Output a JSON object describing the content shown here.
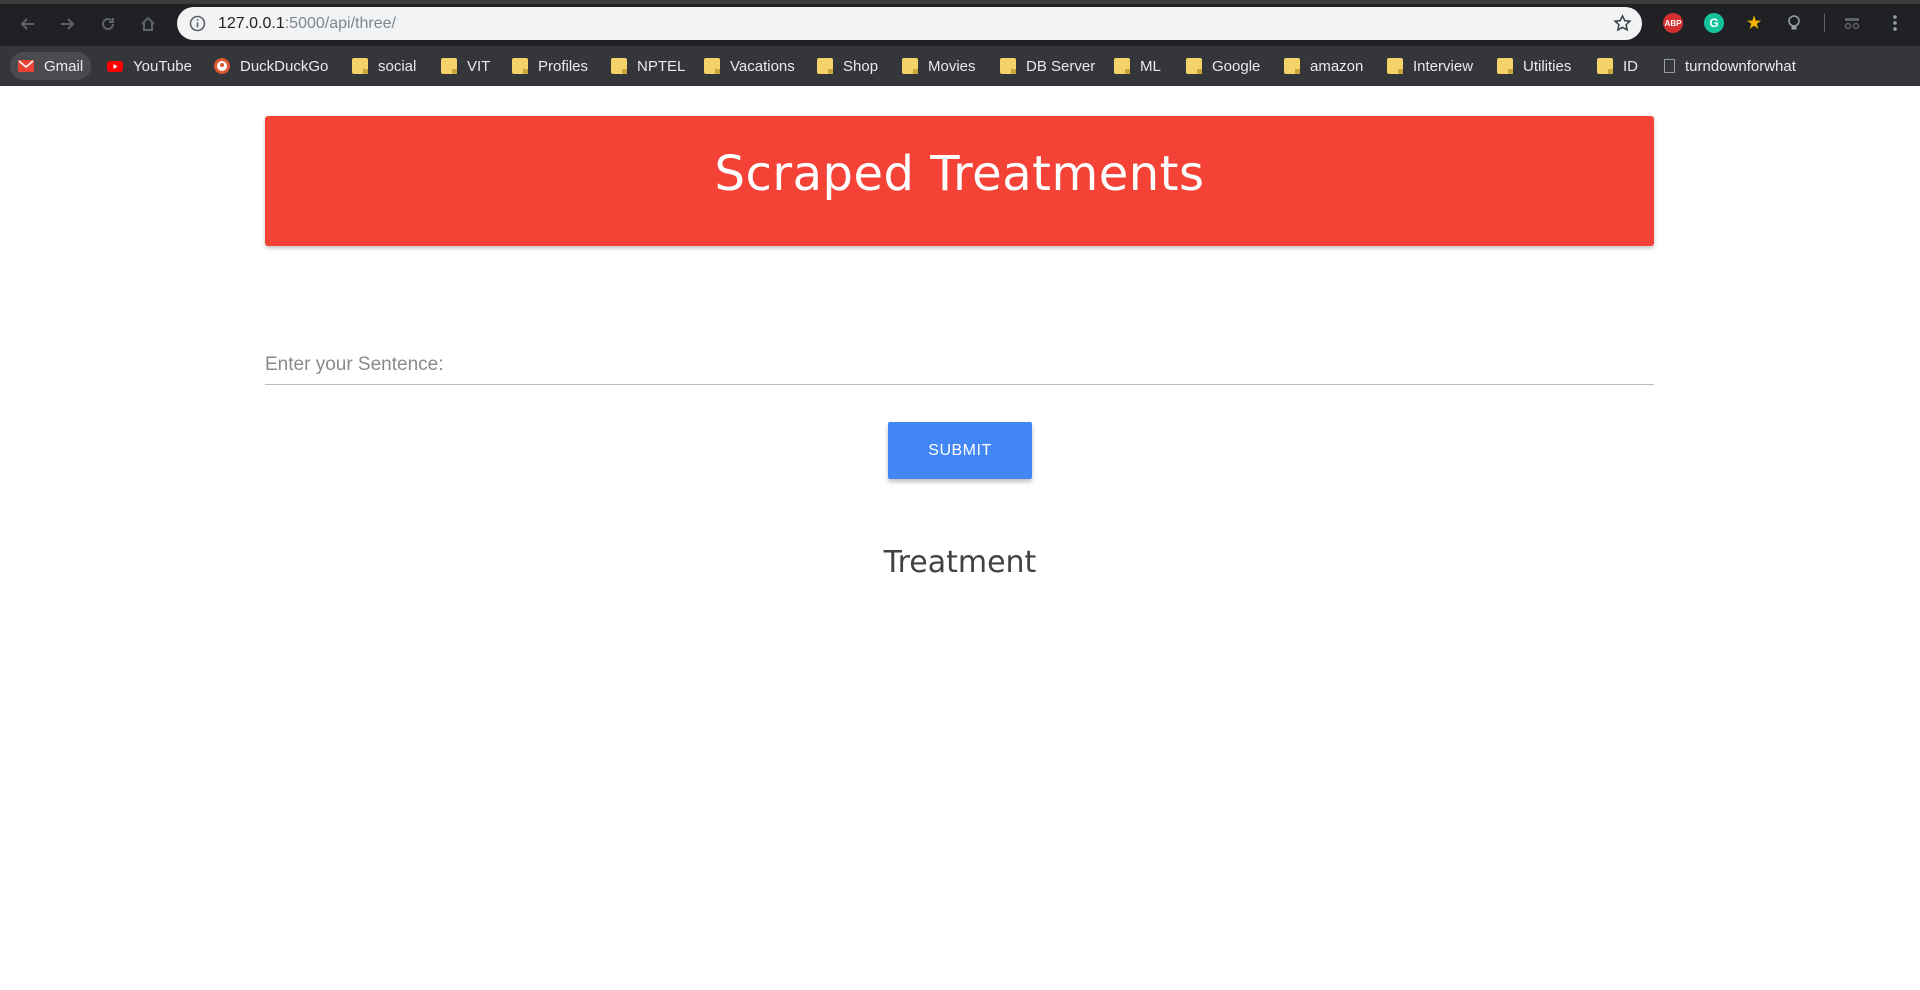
{
  "browser": {
    "url_host": "127.0.0.1",
    "url_rest": ":5000/api/three/",
    "extensions": [
      {
        "name": "ABP",
        "color": "#d32f2f"
      },
      {
        "name": "G",
        "color": "#15c39a"
      },
      {
        "name": "",
        "color": "#f4b400"
      },
      {
        "name": "",
        "color": "#9aa0a6"
      }
    ]
  },
  "bookmarks": [
    {
      "label": "Gmail",
      "icon": "gmail-icon"
    },
    {
      "label": "YouTube",
      "icon": "youtube-icon"
    },
    {
      "label": "DuckDuckGo",
      "icon": "duckduckgo-icon"
    },
    {
      "label": "social",
      "icon": "folder-icon"
    },
    {
      "label": "VIT",
      "icon": "folder-icon"
    },
    {
      "label": "Profiles",
      "icon": "folder-icon"
    },
    {
      "label": "NPTEL",
      "icon": "folder-icon"
    },
    {
      "label": "Vacations",
      "icon": "folder-icon"
    },
    {
      "label": "Shop",
      "icon": "folder-icon"
    },
    {
      "label": "Movies",
      "icon": "folder-icon"
    },
    {
      "label": "DB Server",
      "icon": "folder-icon"
    },
    {
      "label": "ML",
      "icon": "folder-icon"
    },
    {
      "label": "Google",
      "icon": "folder-icon"
    },
    {
      "label": "amazon",
      "icon": "folder-icon"
    },
    {
      "label": "Interview",
      "icon": "folder-icon"
    },
    {
      "label": "Utilities",
      "icon": "folder-icon"
    },
    {
      "label": "ID",
      "icon": "folder-icon"
    },
    {
      "label": "turndownforwhat",
      "icon": "page-icon"
    }
  ],
  "page": {
    "title": "Scraped Treatments",
    "input_placeholder": "Enter your Sentence:",
    "input_value": "",
    "submit_label": "SUBMIT",
    "result_heading": "Treatment"
  },
  "colors": {
    "header": "#f44336",
    "button": "#4285f4"
  }
}
